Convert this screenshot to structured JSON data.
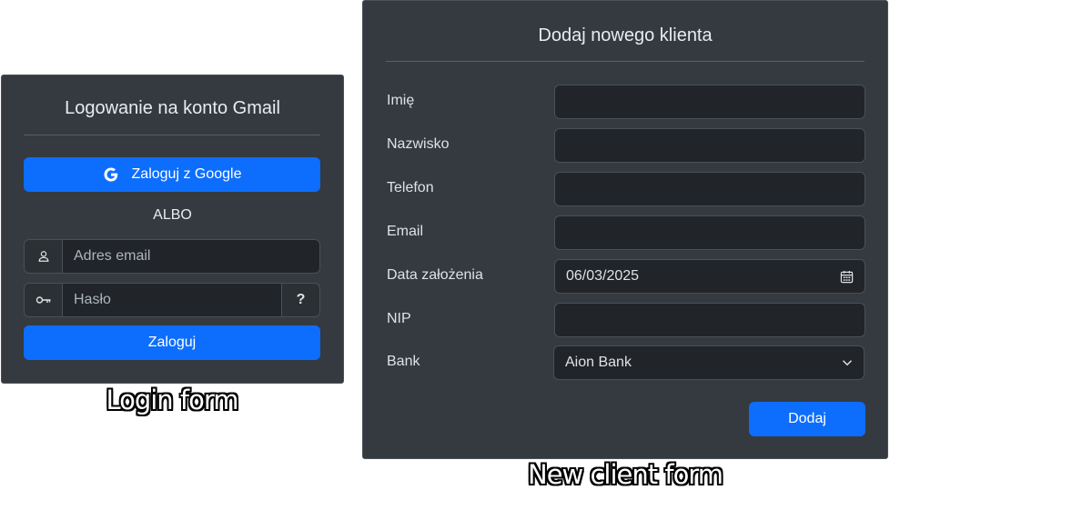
{
  "login_form": {
    "title": "Logowanie na konto Gmail",
    "google_button_label": "Zaloguj z Google",
    "separator_text": "ALBO",
    "email_placeholder": "Adres email",
    "password_placeholder": "Hasło",
    "help_button_label": "?",
    "submit_label": "Zaloguj",
    "caption": "Login form",
    "icons": {
      "google": "google-icon",
      "email": "person-icon",
      "password": "key-icon"
    }
  },
  "client_form": {
    "title": "Dodaj nowego klienta",
    "fields": [
      {
        "label": "Imię",
        "value": ""
      },
      {
        "label": "Nazwisko",
        "value": ""
      },
      {
        "label": "Telefon",
        "value": ""
      },
      {
        "label": "Email",
        "value": ""
      },
      {
        "label": "Data założenia",
        "value": "06/03/2025"
      },
      {
        "label": "NIP",
        "value": ""
      },
      {
        "label": "Bank",
        "value": "Aion Bank"
      }
    ],
    "submit_label": "Dodaj",
    "caption": "New client form",
    "icons": {
      "date": "calendar-icon",
      "select": "chevron-down-icon"
    }
  },
  "colors": {
    "panel_bg": "#343a40",
    "input_bg": "#212529",
    "primary": "#0d6efd",
    "text": "#dee2e6"
  }
}
